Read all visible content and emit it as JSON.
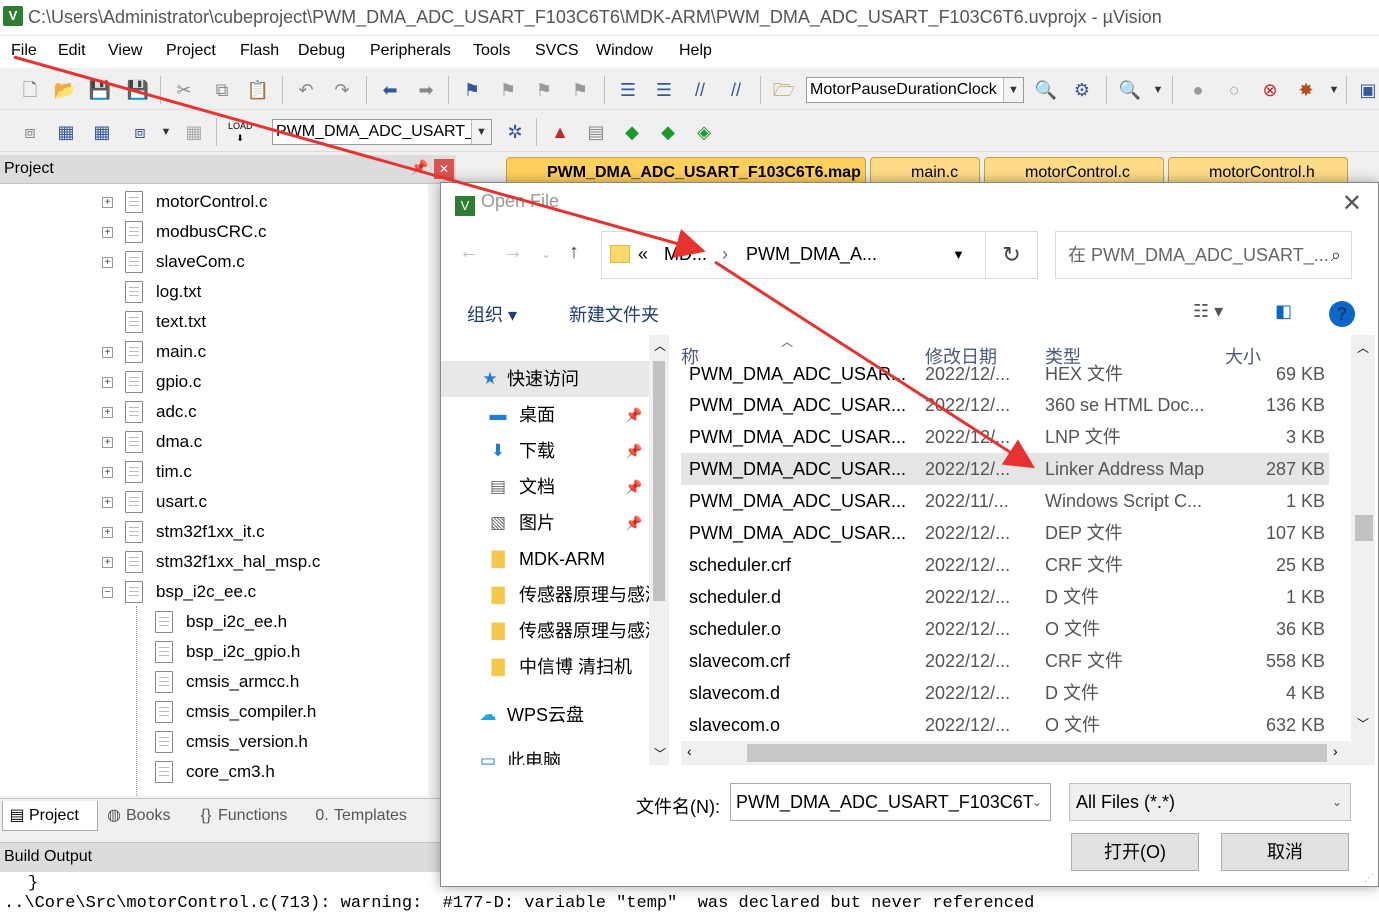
{
  "window": {
    "title": "C:\\Users\\Administrator\\cubeproject\\PWM_DMA_ADC_USART_F103C6T6\\MDK-ARM\\PWM_DMA_ADC_USART_F103C6T6.uvprojx - µVision",
    "app_icon": "V"
  },
  "menu": [
    "File",
    "Edit",
    "View",
    "Project",
    "Flash",
    "Debug",
    "Peripherals",
    "Tools",
    "SVCS",
    "Window",
    "Help"
  ],
  "toolbar": {
    "find_combo": "MotorPauseDurationClock",
    "target_combo": "PWM_DMA_ADC_USART_",
    "load_label": "LOAD"
  },
  "project_panel": {
    "title": "Project",
    "tree": [
      {
        "label": "motorControl.c",
        "expand": "+"
      },
      {
        "label": "modbusCRC.c",
        "expand": "+"
      },
      {
        "label": "slaveCom.c",
        "expand": "+"
      },
      {
        "label": "log.txt",
        "expand": ""
      },
      {
        "label": "text.txt",
        "expand": ""
      },
      {
        "label": "main.c",
        "expand": "+"
      },
      {
        "label": "gpio.c",
        "expand": "+"
      },
      {
        "label": "adc.c",
        "expand": "+"
      },
      {
        "label": "dma.c",
        "expand": "+"
      },
      {
        "label": "tim.c",
        "expand": "+"
      },
      {
        "label": "usart.c",
        "expand": "+"
      },
      {
        "label": "stm32f1xx_it.c",
        "expand": "+"
      },
      {
        "label": "stm32f1xx_hal_msp.c",
        "expand": "+"
      },
      {
        "label": "bsp_i2c_ee.c",
        "expand": "−"
      },
      {
        "label": "bsp_i2c_ee.h",
        "expand": ""
      },
      {
        "label": "bsp_i2c_gpio.h",
        "expand": ""
      },
      {
        "label": "cmsis_armcc.h",
        "expand": ""
      },
      {
        "label": "cmsis_compiler.h",
        "expand": ""
      },
      {
        "label": "cmsis_version.h",
        "expand": ""
      },
      {
        "label": "core_cm3.h",
        "expand": ""
      }
    ],
    "tabs": [
      "Project",
      "Books",
      "Functions",
      "Templates"
    ]
  },
  "build_output": {
    "title": "Build Output",
    "line1": "}",
    "line2": "..\\Core\\Src\\motorControl.c(713): warning:  #177-D: variable \"temp\"  was declared but never referenced"
  },
  "editor_tabs": [
    "PWM_DMA_ADC_USART_F103C6T6.map",
    "main.c",
    "motorControl.c",
    "motorControl.h"
  ],
  "dialog": {
    "title": "Open File",
    "address": {
      "overflow": "«",
      "crumb1": "MD...",
      "sep": "›",
      "crumb2": "PWM_DMA_A..."
    },
    "search_placeholder": "在 PWM_DMA_ADC_USART_...",
    "organize": "组织 ▾",
    "new_folder": "新建文件夹",
    "nav_items": [
      {
        "label": "快速访问",
        "icon": "★",
        "pinned": false
      },
      {
        "label": "桌面",
        "icon": "▬",
        "pinned": true
      },
      {
        "label": "下载",
        "icon": "⬇",
        "pinned": true
      },
      {
        "label": "文档",
        "icon": "▤",
        "pinned": true
      },
      {
        "label": "图片",
        "icon": "▧",
        "pinned": true
      },
      {
        "label": "MDK-ARM",
        "icon": "▇",
        "pinned": false
      },
      {
        "label": "传感器原理与感测",
        "icon": "▇",
        "pinned": false
      },
      {
        "label": "传感器原理与感测",
        "icon": "▇",
        "pinned": false
      },
      {
        "label": "中信博 清扫机",
        "icon": "▇",
        "pinned": false
      },
      {
        "label": "WPS云盘",
        "icon": "☁",
        "pinned": false
      },
      {
        "label": "此电脑",
        "icon": "▭",
        "pinned": false
      }
    ],
    "columns": {
      "name": "称",
      "date": "修改日期",
      "type": "类型",
      "size": "大小"
    },
    "files": [
      {
        "name": "PWM_DMA_ADC_USAR...",
        "date": "2022/12/...",
        "type": "HEX 文件",
        "size": "69 KB"
      },
      {
        "name": "PWM_DMA_ADC_USAR...",
        "date": "2022/12/...",
        "type": "360 se HTML Doc...",
        "size": "136 KB"
      },
      {
        "name": "PWM_DMA_ADC_USAR...",
        "date": "2022/12/...",
        "type": "LNP 文件",
        "size": "3 KB"
      },
      {
        "name": "PWM_DMA_ADC_USAR...",
        "date": "2022/12/...",
        "type": "Linker Address Map",
        "size": "287 KB"
      },
      {
        "name": "PWM_DMA_ADC_USAR...",
        "date": "2022/11/...",
        "type": "Windows Script C...",
        "size": "1 KB"
      },
      {
        "name": "PWM_DMA_ADC_USAR...",
        "date": "2022/12/...",
        "type": "DEP 文件",
        "size": "107 KB"
      },
      {
        "name": "scheduler.crf",
        "date": "2022/12/...",
        "type": "CRF 文件",
        "size": "25 KB"
      },
      {
        "name": "scheduler.d",
        "date": "2022/12/...",
        "type": "D 文件",
        "size": "1 KB"
      },
      {
        "name": "scheduler.o",
        "date": "2022/12/...",
        "type": "O 文件",
        "size": "36 KB"
      },
      {
        "name": "slavecom.crf",
        "date": "2022/12/...",
        "type": "CRF 文件",
        "size": "558 KB"
      },
      {
        "name": "slavecom.d",
        "date": "2022/12/...",
        "type": "D 文件",
        "size": "4 KB"
      },
      {
        "name": "slavecom.o",
        "date": "2022/12/...",
        "type": "O 文件",
        "size": "632 KB"
      }
    ],
    "filename_label": "文件名(N):",
    "filename_value": "PWM_DMA_ADC_USART_F103C6T",
    "filetype": "All Files (*.*)",
    "open_button": "打开(O)",
    "cancel_button": "取消"
  },
  "colors": {
    "annotation_arrow": "#e8322f",
    "tab_active": "#ffd15c",
    "link": "#1d3c6e"
  }
}
